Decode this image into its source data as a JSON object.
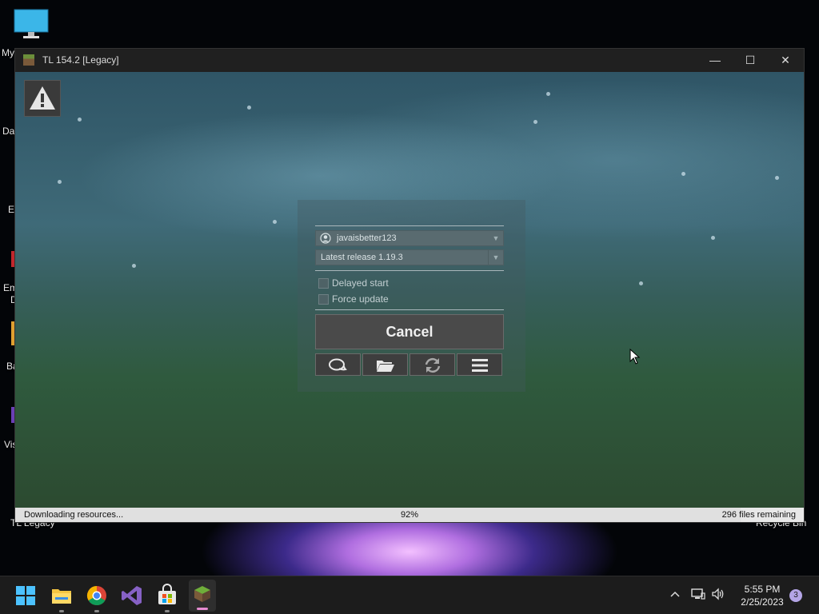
{
  "desktop": {
    "icons": [
      {
        "name": "desktop-icon-my-computer",
        "label": "My"
      },
      {
        "name": "desktop-icon-data",
        "label": "Dat"
      },
      {
        "name": "desktop-icon-ev",
        "label": "Ev"
      },
      {
        "name": "desktop-icon-em",
        "label": "Em"
      },
      {
        "name": "desktop-icon-d",
        "label": "D"
      },
      {
        "name": "desktop-icon-ba",
        "label": "Ba"
      },
      {
        "name": "desktop-icon-vis",
        "label": "Vis"
      },
      {
        "name": "desktop-icon-tl-legacy",
        "label": "TL Legacy"
      },
      {
        "name": "desktop-icon-recycle-bin",
        "label": "Recycle Bin"
      }
    ]
  },
  "window": {
    "title": "TL 154.2 [Legacy]",
    "controls": {
      "minimize": "—",
      "maximize": "☐",
      "close": "✕"
    }
  },
  "launcher": {
    "account": "javaisbetter123",
    "version": "Latest release 1.19.3",
    "delayed_start_label": "Delayed start",
    "force_update_label": "Force update",
    "cancel_label": "Cancel",
    "tool_buttons": [
      "chat-icon",
      "folder-icon",
      "refresh-icon",
      "menu-icon"
    ]
  },
  "status": {
    "message": "Downloading resources...",
    "percent_text": "92%",
    "progress": 0.92,
    "remaining": "296 files remaining"
  },
  "taskbar": {
    "apps": [
      "start-icon",
      "file-explorer-icon",
      "chrome-icon",
      "visual-studio-icon",
      "store-icon",
      "tl-legacy-icon"
    ],
    "time": "5:55 PM",
    "date": "2/25/2023",
    "notifications": "3"
  },
  "colors": {
    "accent": "#5aa9e6",
    "window_bg": "#2a4a58",
    "titlebar": "#202020",
    "taskbar": "#1c1c1c"
  }
}
